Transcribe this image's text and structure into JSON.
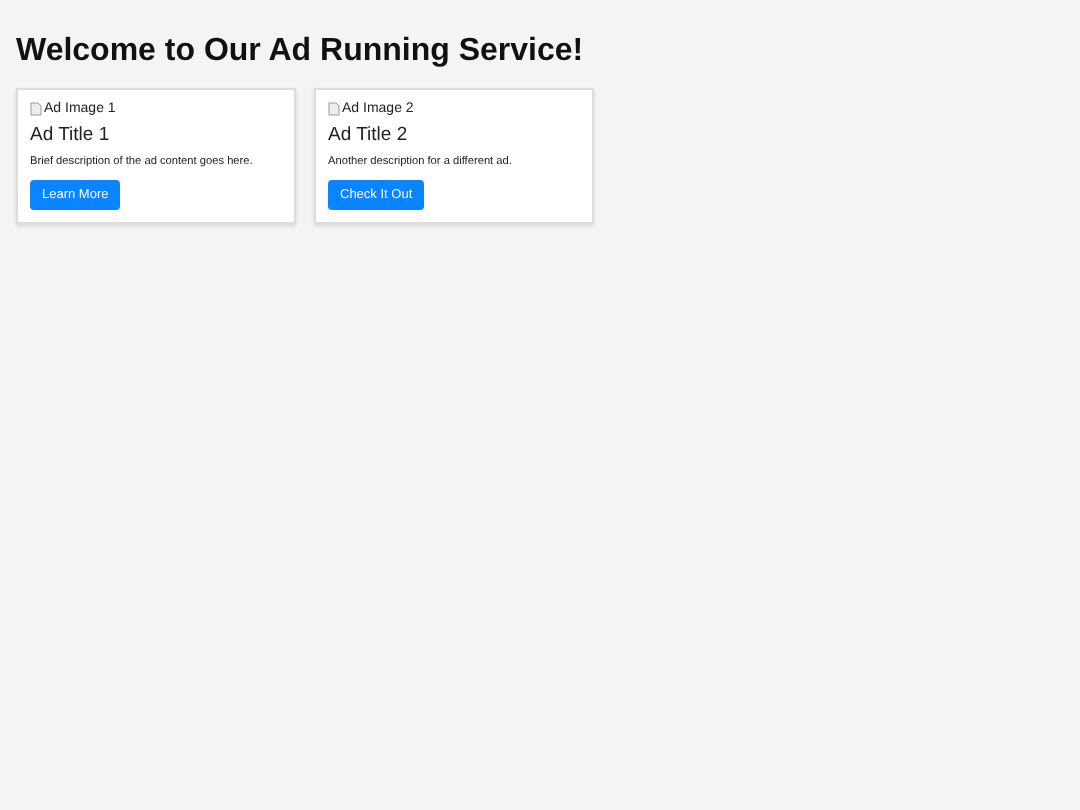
{
  "heading": "Welcome to Our Ad Running Service!",
  "ads": [
    {
      "image_alt": "Ad Image 1",
      "title": "Ad Title 1",
      "description": "Brief description of the ad content goes here.",
      "button": "Learn More"
    },
    {
      "image_alt": "Ad Image 2",
      "title": "Ad Title 2",
      "description": "Another description for a different ad.",
      "button": "Check It Out"
    }
  ]
}
